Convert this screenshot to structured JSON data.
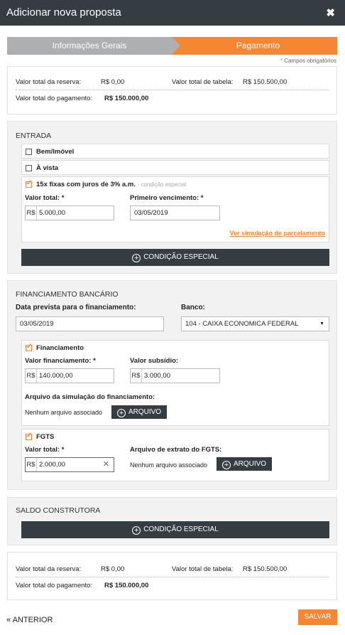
{
  "header": {
    "title": "Adicionar nova proposta",
    "close_icon": "close-icon"
  },
  "steps": [
    {
      "label": "Informações Gerais"
    },
    {
      "label": "Pagamento"
    }
  ],
  "required_note": "Campos obrigatórios",
  "summary": {
    "reserva_label": "Valor total da reserva:",
    "reserva_value": "R$ 0,00",
    "tabela_label": "Valor total de tabela:",
    "tabela_value": "R$ 150.500,00",
    "pagamento_label": "Valor total do pagamento:",
    "pagamento_value": "R$ 150.000,00"
  },
  "entrada": {
    "title": "ENTRADA",
    "option_bem": "Bem/Imóvel",
    "option_avista": "À vista",
    "option_parcelado": "15x fixas com juros de 3% a.m.",
    "option_parcelado_note": "- condição especial",
    "valor_total_label": "Valor total: *",
    "valor_total_prefix": "R$",
    "valor_total_value": "5.000,00",
    "vencimento_label": "Primeiro vencimento: *",
    "vencimento_value": "03/05/2019",
    "simulacao_link": "Ver simulação de parcelamento",
    "condicao_button": "CONDIÇÃO ESPECIAL"
  },
  "financiamento": {
    "title": "FINANCIAMENTO BANCÁRIO",
    "data_label": "Data prevista para o financiamento:",
    "data_value": "03/05/2019",
    "banco_label": "Banco:",
    "banco_value": "104 - CAIXA ECONOMICA FEDERAL",
    "fin_checkbox": "Financiamento",
    "valor_fin_label": "Valor financiamento: *",
    "valor_fin_prefix": "R$",
    "valor_fin_value": "140.000,00",
    "subsidio_label": "Valor subsídio:",
    "subsidio_prefix": "R$",
    "subsidio_value": "3.000,00",
    "arquivo_label": "Arquivo da simulação do financiamento:",
    "arquivo_none": "Nenhum arquivo associado",
    "arquivo_button": "ARQUIVO",
    "fgts_checkbox": "FGTS",
    "fgts_valor_label": "Valor total: *",
    "fgts_prefix": "R$",
    "fgts_value": "2.000,00",
    "fgts_arquivo_label": "Arquivo de extrato do FGTS:",
    "fgts_arquivo_none": "Nenhum arquivo associado",
    "fgts_arquivo_button": "ARQUIVO"
  },
  "saldo": {
    "title": "SALDO CONSTRUTORA",
    "condicao_button": "CONDIÇÃO ESPECIAL"
  },
  "footer": {
    "prev_label": "« ANTERIOR",
    "save_label": "SALVAR"
  },
  "colors": {
    "accent": "#f58634",
    "dark": "#353c42",
    "step_inactive": "#adafb1"
  }
}
